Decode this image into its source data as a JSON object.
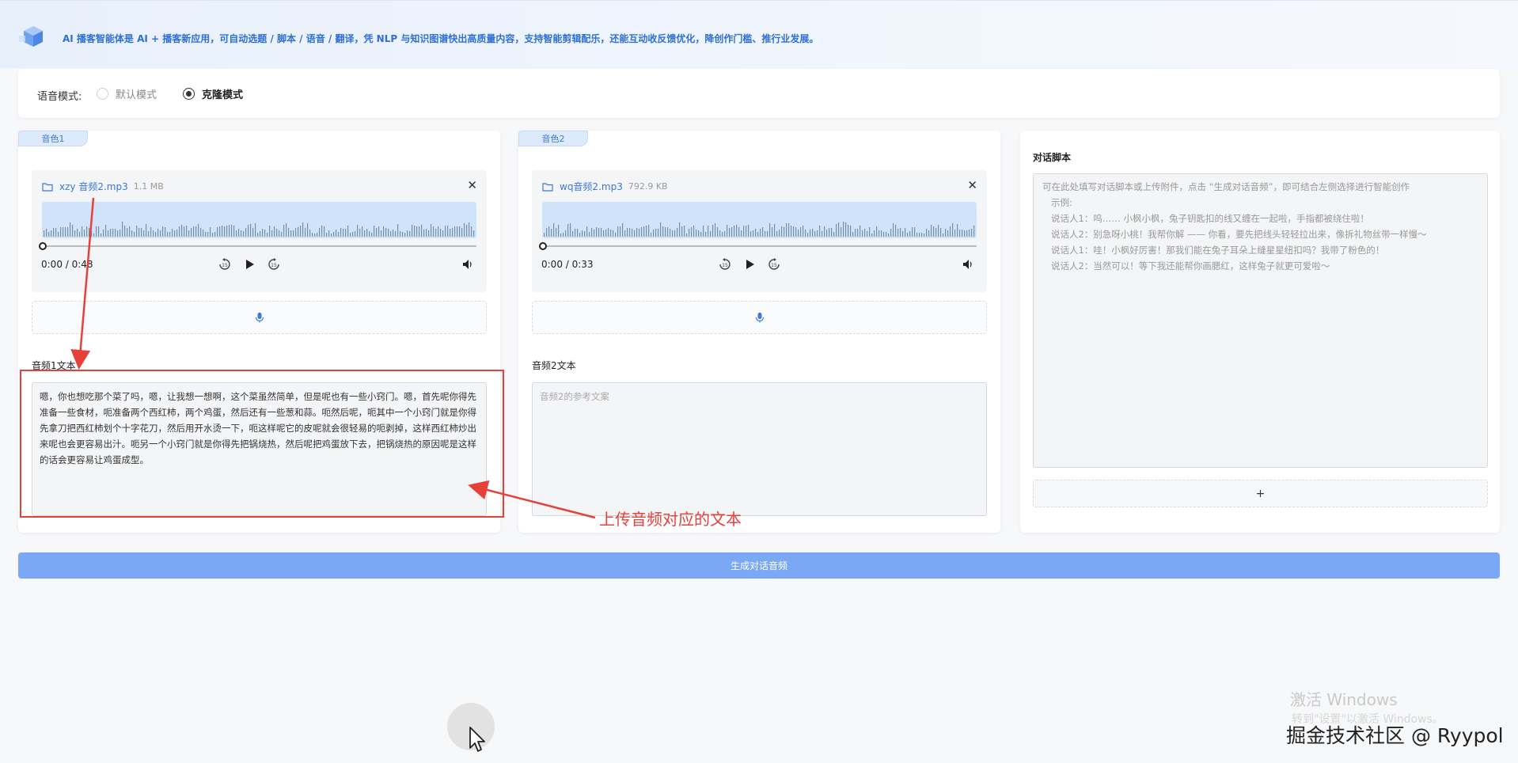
{
  "banner": {
    "text": "AI 播客智能体是 AI + 播客新应用，可自动选题 / 脚本 / 语音 / 翻译，凭 NLP 与知识图谱快出高质量内容，支持智能剪辑配乐，还能互动收反馈优化，降创作门槛、推行业发展。",
    "logo_icon": "cube-logo-icon"
  },
  "voice_mode": {
    "label": "语音模式:",
    "options": [
      "默认模式",
      "克隆模式"
    ],
    "selected": "克隆模式"
  },
  "voices": [
    {
      "tag": "音色1",
      "file_name": "xzy 音频2.mp3",
      "file_size": "1.1 MB",
      "time": "0:00 / 0:48",
      "text_label": "音频1文本",
      "text_value": "嗯，你也想吃那个菜了吗，嗯，让我想一想啊，这个菜虽然简单，但是呢也有一些小窍门。嗯，首先呢你得先准备一些食材，呃准备两个西红柿，两个鸡蛋，然后还有一些葱和蒜。呃然后呢，呃其中一个小窍门就是你得先拿刀把西红柿划个十字花刀，然后用开水烫一下，呃这样呢它的皮呢就会很轻易的呃剥掉，这样西红柿炒出来呢也会更容易出汁。呃另一个小窍门就是你得先把锅烧热，然后呢把鸡蛋放下去，把锅烧热的原因呢是这样的话会更容易让鸡蛋成型。",
      "text_placeholder": ""
    },
    {
      "tag": "音色2",
      "file_name": "wq音频2.mp3",
      "file_size": "792.9 KB",
      "time": "0:00 / 0:33",
      "text_label": "音频2文本",
      "text_value": "",
      "text_placeholder": "音频2的参考文案"
    }
  ],
  "script": {
    "title": "对话脚本",
    "placeholder": "可在此处填写对话脚本或上传附件，点击 “生成对话音频”，即可结合左侧选择进行智能创作\n   示例:\n   说话人1：呜…… 小枫小枫，兔子钥匙扣的线又缠在一起啦，手指都被绕住啦！\n   说话人2：别急呀小桃！我帮你解 —— 你看，要先把线头轻轻拉出来，像拆礼物丝带一样慢～\n   说话人1：哇！小枫好厉害！那我们能在兔子耳朵上缝星星纽扣吗？我带了粉色的！\n   说话人2：当然可以！等下我还能帮你画腮红，这样兔子就更可爱啦～",
    "add_label": "+"
  },
  "generate_button": "生成对话音频",
  "annotation": {
    "label": "上传音频对应的文本",
    "color": "#e5403a"
  },
  "watermark": {
    "line1": "激活 Windows",
    "line2": "转到\"设置\"以激活 Windows。"
  },
  "credit": "掘金技术社区 @ Ryypol",
  "colors": {
    "accent": "#3c78d8",
    "generate_bg": "#7aa8f4",
    "wave_bg": "#cfe3fa"
  }
}
